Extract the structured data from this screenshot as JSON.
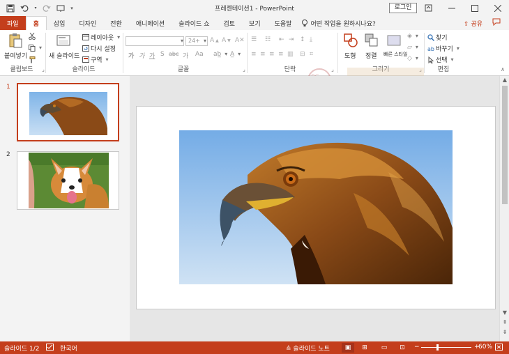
{
  "app": {
    "title": "프레젠테이션1  -  PowerPoint",
    "login_label": "로그인"
  },
  "qat": {
    "save_icon": "save-icon",
    "undo_icon": "undo-icon",
    "redo_icon": "redo-icon",
    "present_icon": "present-from-start-icon"
  },
  "tabs": [
    {
      "label": "파일"
    },
    {
      "label": "홈"
    },
    {
      "label": "삽입"
    },
    {
      "label": "디자인"
    },
    {
      "label": "전환"
    },
    {
      "label": "애니메이션"
    },
    {
      "label": "슬라이드 쇼"
    },
    {
      "label": "검토"
    },
    {
      "label": "보기"
    },
    {
      "label": "도움말"
    }
  ],
  "tellme": {
    "label": "어떤 작업을 원하시나요?"
  },
  "share": {
    "label": "공유"
  },
  "ribbon": {
    "clipboard": {
      "paste_label": "붙여넣기",
      "group_label": "클립보드"
    },
    "slides": {
      "new_slide_label": "새 슬라이드",
      "layout_label": "레이아웃",
      "reset_label": "다시 설정",
      "section_label": "구역",
      "group_label": "슬라이드"
    },
    "font": {
      "font_size": "24+",
      "group_label": "글꼴",
      "format_buttons": [
        "가",
        "가",
        "가",
        "S",
        "abc",
        "가",
        "Aa"
      ]
    },
    "paragraph": {
      "group_label": "단락"
    },
    "drawing": {
      "shapes_label": "도형",
      "arrange_label": "정렬",
      "quick_styles_label": "빠른 스타일",
      "group_label": "그리기"
    },
    "editing": {
      "find_label": "찾기",
      "replace_label": "바꾸기",
      "select_label": "선택",
      "group_label": "편집"
    }
  },
  "thumbnails": [
    {
      "number": "1",
      "selected": true,
      "image": "eagle-image"
    },
    {
      "number": "2",
      "selected": false,
      "image": "corgi-image"
    }
  ],
  "statusbar": {
    "slide_info": "슬라이드 1/2",
    "language": "한국어",
    "notes_label": "슬라이드 노트",
    "zoom": "60%",
    "zoom_fraction": 0.6
  },
  "colors": {
    "accent": "#c43e1c",
    "status_bg": "#c43e1c"
  }
}
